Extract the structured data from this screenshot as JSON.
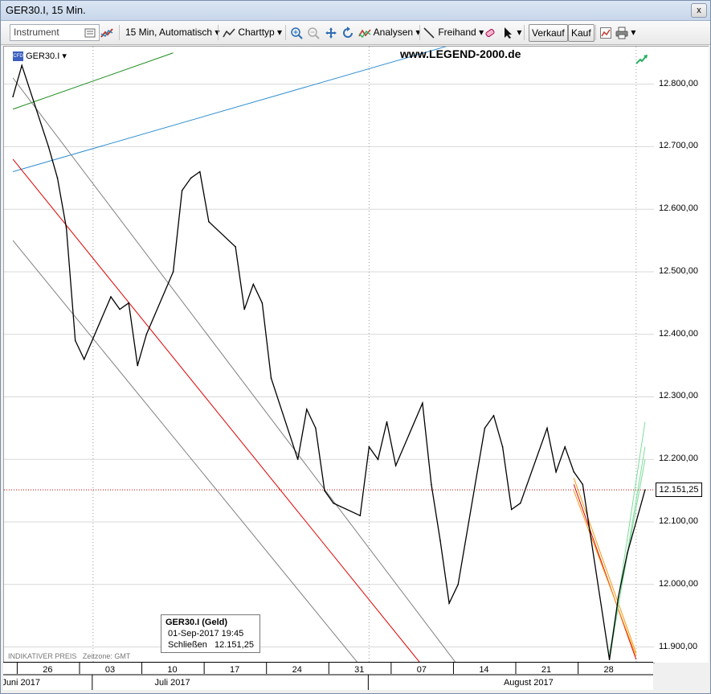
{
  "window": {
    "title": "GER30.I, 15 Min.",
    "close_glyph": "x"
  },
  "toolbar": {
    "instrument_placeholder": "Instrument",
    "interval_label": "15 Min,  Automatisch",
    "charttype_label": "Charttyp",
    "analysen_label": "Analysen",
    "freihand_label": "Freihand",
    "verkauf_label": "Verkauf",
    "kauf_label": "Kauf"
  },
  "legend_symbol": "GER30.I",
  "watermark": "www.LEGEND-2000.de",
  "footer": {
    "indicative": "INDIKATIVER PREIS",
    "timezone": "Zeitzone: GMT"
  },
  "info_box": {
    "title": "GER30.I (Geld)",
    "datetime": "01-Sep-2017 19:45",
    "close_label": "Schließen",
    "close_value": "12.151,25"
  },
  "colors": {
    "price_line": "#000000",
    "support": "#e00000",
    "channel_grey": "#808080",
    "trend_green": "#1e8c1e",
    "trend_blue": "#2f8fd0",
    "orange": "#f39c12",
    "light_green": "#7ddc9a",
    "last_price_line": "#c00000"
  },
  "chart_data": {
    "type": "line",
    "title": "GER30.I, 15 Min.",
    "ylim": [
      11875,
      12860
    ],
    "yticks": [
      "12.800,00",
      "12.700,00",
      "12.600,00",
      "12.500,00",
      "12.400,00",
      "12.300,00",
      "12.200,00",
      "12.100,00",
      "12.000,00",
      "11.900,00"
    ],
    "ytick_values": [
      12800,
      12700,
      12600,
      12500,
      12400,
      12300,
      12200,
      12100,
      12000,
      11900
    ],
    "xticks": [
      "26",
      "03",
      "10",
      "17",
      "24",
      "31",
      "07",
      "14",
      "21",
      "28"
    ],
    "months": [
      "Juni 2017",
      "Juli 2017",
      "August 2017"
    ],
    "last_price": 12151.25,
    "last_price_label": "12.151,25",
    "x": [
      "2017-06-22",
      "2017-06-23",
      "2017-06-26",
      "2017-06-27",
      "2017-06-28",
      "2017-06-29",
      "2017-06-30",
      "2017-07-03",
      "2017-07-04",
      "2017-07-05",
      "2017-07-06",
      "2017-07-07",
      "2017-07-10",
      "2017-07-11",
      "2017-07-12",
      "2017-07-13",
      "2017-07-14",
      "2017-07-17",
      "2017-07-18",
      "2017-07-19",
      "2017-07-20",
      "2017-07-21",
      "2017-07-24",
      "2017-07-25",
      "2017-07-26",
      "2017-07-27",
      "2017-07-28",
      "2017-07-31",
      "2017-08-01",
      "2017-08-02",
      "2017-08-03",
      "2017-08-04",
      "2017-08-07",
      "2017-08-08",
      "2017-08-09",
      "2017-08-10",
      "2017-08-11",
      "2017-08-14",
      "2017-08-15",
      "2017-08-16",
      "2017-08-17",
      "2017-08-18",
      "2017-08-21",
      "2017-08-22",
      "2017-08-23",
      "2017-08-24",
      "2017-08-25",
      "2017-08-28",
      "2017-08-29",
      "2017-08-30",
      "2017-08-31",
      "2017-09-01"
    ],
    "series": [
      {
        "values": [
          12780,
          12830,
          12700,
          12650,
          12570,
          12390,
          12360,
          12460,
          12440,
          12450,
          12350,
          12400,
          12500,
          12630,
          12650,
          12660,
          12580,
          12540,
          12440,
          12480,
          12450,
          12330,
          12200,
          12280,
          12250,
          12150,
          12130,
          12110,
          12220,
          12200,
          12260,
          12190,
          12290,
          12160,
          12070,
          11970,
          12000,
          12250,
          12270,
          12220,
          12120,
          12130,
          12250,
          12180,
          12220,
          12180,
          12160,
          11880,
          11980,
          12050,
          12100,
          12151.25
        ]
      }
    ],
    "trendlines": [
      {
        "name": "green",
        "from": [
          "2017-06-22",
          12760
        ],
        "to": [
          "2017-07-10",
          12850
        ]
      },
      {
        "name": "blue",
        "from": [
          "2017-06-22",
          12660
        ],
        "to": [
          "2017-08-12",
          12870
        ]
      },
      {
        "name": "grey-upper",
        "from": [
          "2017-06-22",
          12810
        ],
        "to": [
          "2017-08-11",
          11870
        ]
      },
      {
        "name": "grey-lower",
        "from": [
          "2017-06-22",
          12550
        ],
        "to": [
          "2017-07-31",
          11870
        ]
      },
      {
        "name": "red",
        "from": [
          "2017-06-22",
          12680
        ],
        "to": [
          "2017-08-07",
          11870
        ]
      }
    ]
  }
}
